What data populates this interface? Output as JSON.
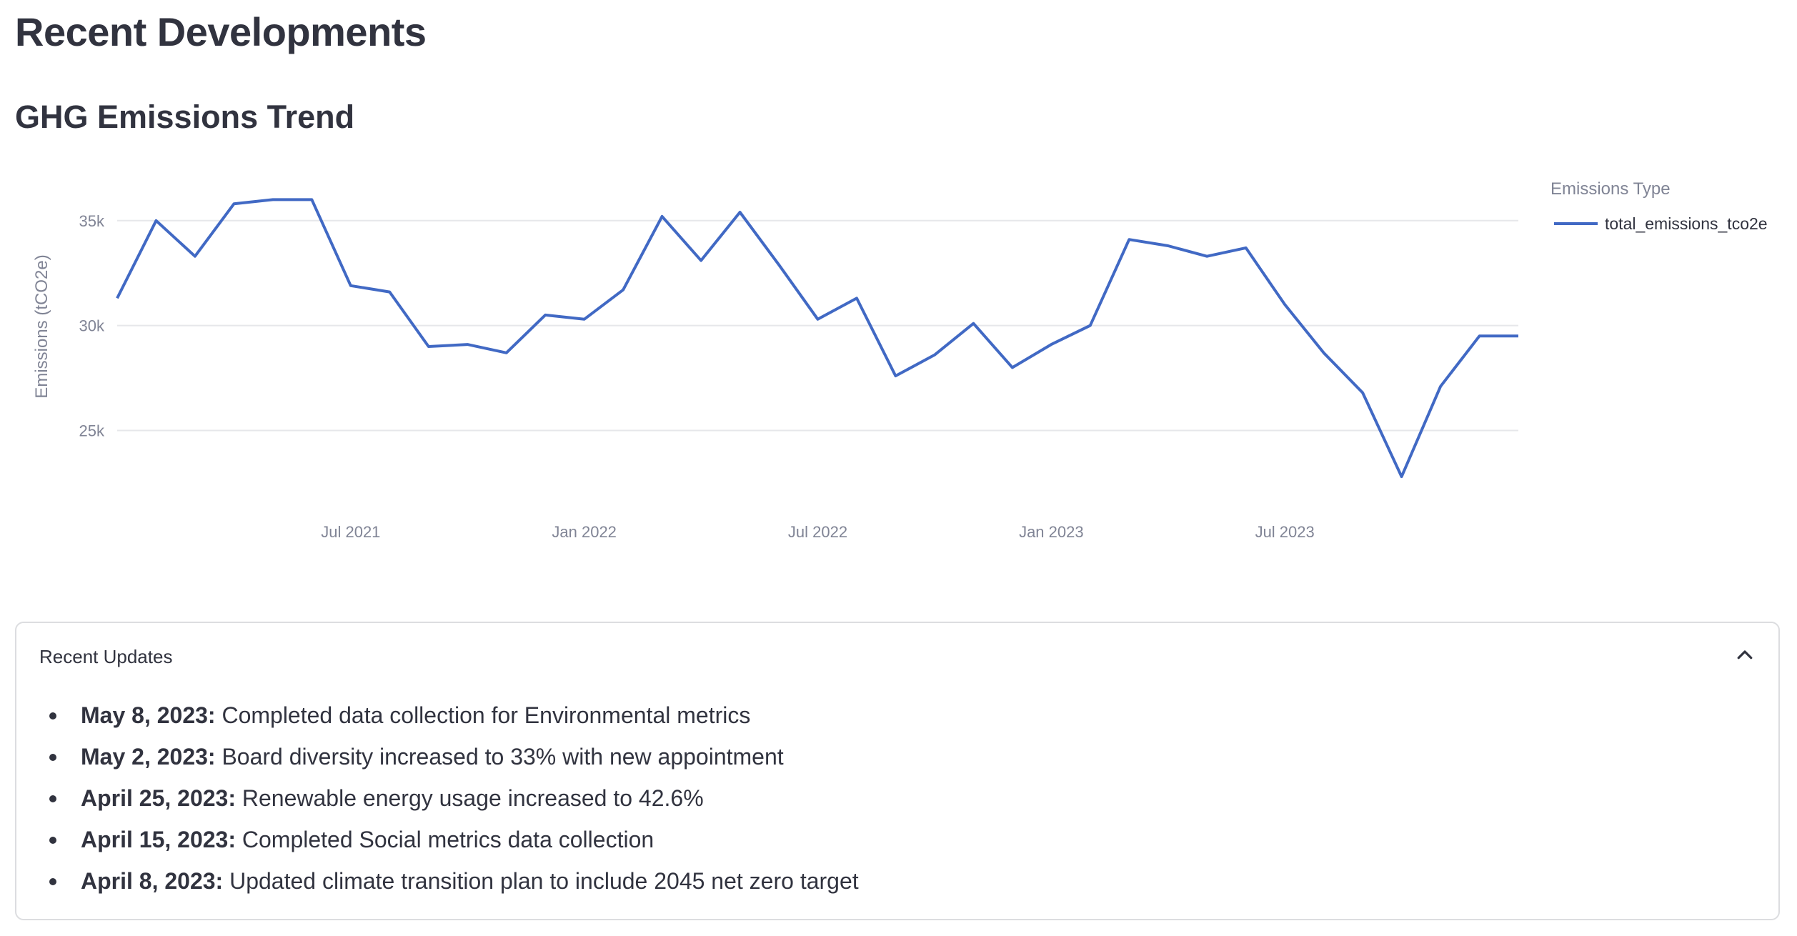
{
  "page": {
    "title": "Recent Developments",
    "subtitle": "GHG Emissions Trend"
  },
  "chart_data": {
    "type": "line",
    "title": "",
    "xlabel": "",
    "ylabel": "Emissions (tCO2e)",
    "y_ticks": [
      25000,
      30000,
      35000
    ],
    "y_tick_labels": [
      "25k",
      "30k",
      "35k"
    ],
    "x_ticks": [
      "2021-07",
      "2022-01",
      "2022-07",
      "2023-01",
      "2023-07"
    ],
    "x_tick_labels": [
      "Jul 2021",
      "Jan 2022",
      "Jul 2022",
      "Jan 2023",
      "Jul 2023"
    ],
    "grid": true,
    "legend": {
      "title": "Emissions Type",
      "placement": "top-right"
    },
    "series": [
      {
        "name": "total_emissions_tco2e",
        "color": "#4169c4",
        "x": [
          "2021-01",
          "2021-02",
          "2021-03",
          "2021-04",
          "2021-05",
          "2021-06",
          "2021-07",
          "2021-08",
          "2021-09",
          "2021-10",
          "2021-11",
          "2021-12",
          "2022-01",
          "2022-02",
          "2022-03",
          "2022-04",
          "2022-05",
          "2022-06",
          "2022-07",
          "2022-08",
          "2022-09",
          "2022-10",
          "2022-11",
          "2022-12",
          "2023-01",
          "2023-02",
          "2023-03",
          "2023-04",
          "2023-05",
          "2023-06",
          "2023-07",
          "2023-08",
          "2023-09",
          "2023-10",
          "2023-11",
          "2023-12",
          "2024-01"
        ],
        "values": [
          31300,
          35000,
          33300,
          35800,
          36000,
          36000,
          31900,
          31600,
          29000,
          29100,
          28700,
          30500,
          30300,
          31700,
          35200,
          33100,
          35400,
          32900,
          30300,
          31300,
          27600,
          28600,
          30100,
          28000,
          29100,
          30000,
          34100,
          33800,
          33300,
          33700,
          31000,
          28700,
          26800,
          22800,
          27100,
          29500,
          29500
        ]
      }
    ]
  },
  "updates": {
    "title": "Recent Updates",
    "items": [
      {
        "date": "May 8, 2023:",
        "text": " Completed data collection for Environmental metrics"
      },
      {
        "date": "May 2, 2023:",
        "text": " Board diversity increased to 33% with new appointment"
      },
      {
        "date": "April 25, 2023:",
        "text": " Renewable energy usage increased to 42.6%"
      },
      {
        "date": "April 15, 2023:",
        "text": " Completed Social metrics data collection"
      },
      {
        "date": "April 8, 2023:",
        "text": " Updated climate transition plan to include 2045 net zero target"
      }
    ]
  }
}
